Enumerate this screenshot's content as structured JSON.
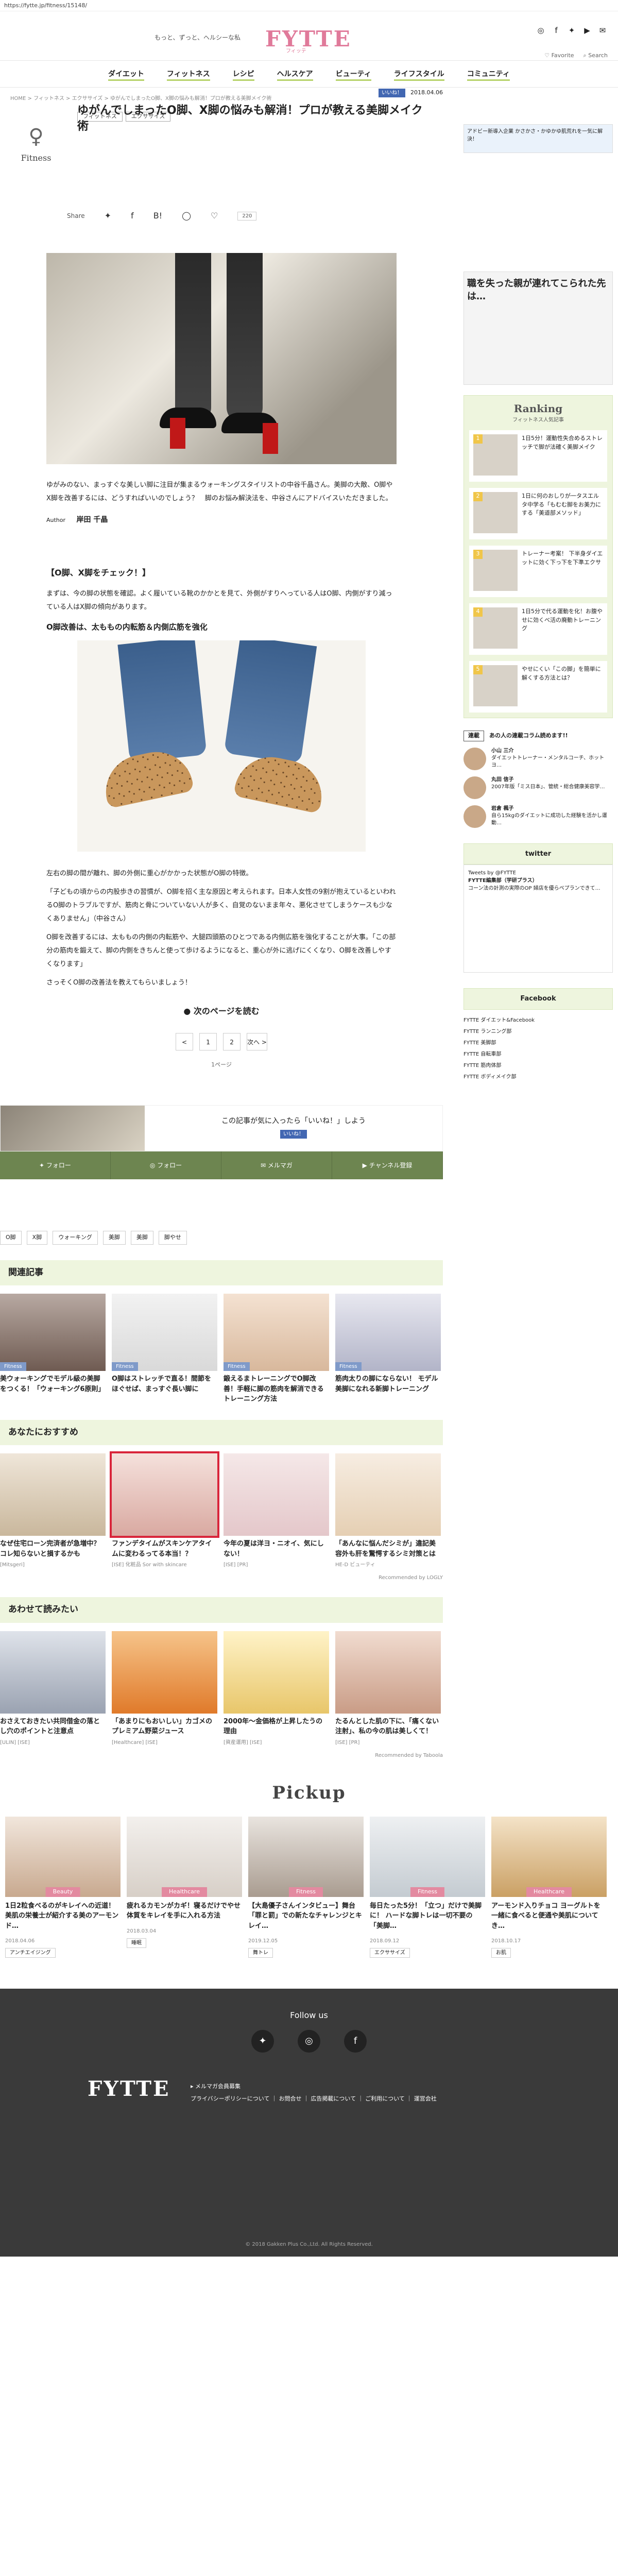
{
  "url": "https://fytte.jp/fitness/15148/",
  "header": {
    "tagline": "もっと、ずっと、ヘルシーな私",
    "logo": "FYTTE",
    "logo_sub": "フィッテ",
    "favorite": "Favorite",
    "search": "Search"
  },
  "nav": [
    "ダイエット",
    "フィットネス",
    "レシピ",
    "ヘルスケア",
    "ビューティ",
    "ライフスタイル",
    "コミュニティ"
  ],
  "breadcrumb": "HOME > フィットネス > エクササイズ > ゆがんでしまったO脚、X脚の悩みも解消！プロが教える美脚メイク術",
  "article": {
    "category": "Fitness",
    "tags": [
      "フィットネス",
      "エクササイズ"
    ],
    "title": "ゆがんでしまったO脚、X脚の悩みも解消！プロが教える美脚メイク術",
    "date": "2018.04.06",
    "like_label": "いいね！",
    "share_label": "Share",
    "share_count": "220",
    "bookmark_label": "B!",
    "lede": "ゆがみのない、まっすぐな美しい脚に注目が集まるウォーキングスタイリストの中谷千晶さん。美脚の大敵、O脚やX脚を改善するには、どうすればいいのでしょう？　脚のお悩み解決法を、中谷さんにアドバイスいただきました。",
    "author_label": "Author",
    "author": "岸田 千晶",
    "sec1_title": "【O脚、X脚をチェック！】",
    "sec1_p": "まずは、今の脚の状態を確認。よく履いている靴のかかとを見て、外側がすりへっている人はO脚、内側がすり減っている人はX脚の傾向があります。",
    "sec1_h3": "O脚改善は、太ももの内転筋＆内側広筋を強化",
    "p2": "左右の脚の間が離れ、脚の外側に重心がかかった状態がO脚の特徴。",
    "p3": "「子どもの頃からの内股歩きの習慣が、O脚を招く主な原因と考えられます。日本人女性の9割が抱えているといわれるO脚のトラブルですが、筋肉と骨についていない人が多く、自覚のないまま年々、悪化させてしまうケースも少なくありません」（中谷さん）",
    "p4": "O脚を改善するには、太ももの内側の内転筋や、大腿四頭筋のひとつである内側広筋を強化することが大事。「この部分の筋肉を鍛えて、脚の内側をきちんと使って歩けるようになると、重心が外に逃げにくくなり、O脚を改善しやすくなります」",
    "p5": "さっそくO脚の改善法を教えてもらいましょう！",
    "next_page": "次のページを読む",
    "pager": [
      "<",
      "1",
      "2",
      "次へ >"
    ],
    "one_page": "1ページ",
    "like_box_text": "この記事が気に入ったら「いいね！」しよう",
    "follow": [
      "フォロー",
      "フォロー",
      "メルマガ",
      "チャンネル登録"
    ],
    "keywords": [
      "O脚",
      "X脚",
      "ウォーキング",
      "美脚",
      "美脚",
      "脚やせ"
    ]
  },
  "related": {
    "title": "関連記事",
    "items": [
      {
        "label": "Fitness",
        "text": "美ウォーキングでモデル級の美脚をつくる！「ウォーキング6原則」"
      },
      {
        "label": "Fitness",
        "text": "O脚はストレッチで直る！間節をほぐせば、まっすぐ長い脚に"
      },
      {
        "label": "Fitness",
        "text": "鍛えるまトレーニングでO脚改善！手軽に脚の筋肉を解消できるトレーニング方法"
      },
      {
        "label": "Fitness",
        "text": "筋肉太りの脚にならない！ モデル美脚になれる新脚トレーニング"
      }
    ]
  },
  "recommend": {
    "title": "あなたにおすすめ",
    "items": [
      {
        "text": "なぜ住宅ローン完済者が急増中？ コレ知らないと損するかも",
        "src": "[Mitsgeri]"
      },
      {
        "text": "ファンデタイムがスキンケアタイムに変わるってる本当！？",
        "src": "[ISE] 化粧品 Sor with skincare"
      },
      {
        "text": "今年の夏は洋ヨ・ニオイ、気にしない！",
        "src": "[ISE] [PR]"
      },
      {
        "text": "「あんなに悩んだシミが」違記美容外も肝を驚愕するシミ対策とは",
        "src": "HE-D ビューティ"
      }
    ],
    "credit": "Recommended by LOGLY"
  },
  "readalso": {
    "title": "あわせて読みたい",
    "items": [
      {
        "text": "おさえておきたい共同借金の落とし穴のポイントと注意点",
        "src": "[ULIN] [ISE]"
      },
      {
        "text": "「あまりにもおいしい」カゴメのプレミアム野菜ジュース",
        "src": "[Healthcare] [ISE]"
      },
      {
        "text": "2000年〜金価格が上昇したうの理由",
        "src": "[資産運用] [ISE]"
      },
      {
        "text": "たるんとした肌の下に、「痛くない注射」、私の今の肌は美しくて！",
        "src": "[ISE] [PR]"
      }
    ],
    "credit": "Recommended by Taboola"
  },
  "pickup": {
    "title": "Pickup",
    "items": [
      {
        "label": "Beauty",
        "text": "1日2粒食べるのがキレイへの近道！美肌の栄養士が紹介する美のアーモンド…",
        "date": "2018.04.06",
        "tag": "アンチエイジング"
      },
      {
        "label": "Healthcare",
        "text": "疲れるカモンがカギ！寝るだけでやせ体質をキレイを手に入れる方法",
        "date": "2018.03.04",
        "tag": "睡眠"
      },
      {
        "label": "Fitness",
        "text": "【大島優子さんインタビュー】舞台「罪と罰」での新たなチャレンジとキレイ…",
        "date": "2019.12.05",
        "tag": "舞トレ"
      },
      {
        "label": "Fitness",
        "text": "毎日たった5分！「立つ」だけで美脚に！ ハードな脚トレは一切不要の「美脚…",
        "date": "2018.09.12",
        "tag": "エクササイズ"
      },
      {
        "label": "Healthcare",
        "text": "アーモンド入りチョコ ヨーグルトを一緒に食べると便通や美肌についてき…",
        "date": "2018.10.17",
        "tag": "お肌"
      }
    ]
  },
  "sidebar": {
    "ad_text": "アドビー新導入企業 かさかさ・かゆかゆ肌荒れを一気に解決！",
    "ad2_text": "職を失った親が連れてこられた先は…",
    "ranking_title": "Ranking",
    "ranking_sub": "フィットネス人気記事",
    "ranking": [
      {
        "n": "1",
        "text": "1日5分！運動性失合めるストレッチで脚が法確く美脚メイク"
      },
      {
        "n": "2",
        "text": "1日に何のおしりが一タスエルタ中学る「もむむ脚をお美力にする「美道部メソッド」"
      },
      {
        "n": "3",
        "text": "トレーナー考案！ 下半身ダイエットに効く下っ下を下準エクサ"
      },
      {
        "n": "4",
        "text": "1日5分で代る運動を化！お腹やせに効くべ活の廃動トレーニング"
      },
      {
        "n": "5",
        "text": "やせにくい「この脚」を簡単に解くする方法とは？"
      }
    ],
    "serial_badge": "連載",
    "serial_title": "あの人の連載コラム読めます!!",
    "people": [
      {
        "name": "小山 三介",
        "desc": "ダイエットトレーナー・メンタルコーチ、ホットヨ…"
      },
      {
        "name": "丸田 信子",
        "desc": "2007年版「ミス日本」、管統・総合健康美容学…"
      },
      {
        "name": "岩倉 楓子",
        "desc": "自ら15kgのダイエットに成功した経験を活かし運動…"
      }
    ],
    "twitter": "twitter",
    "tw_head": "Tweets by @FYTTE",
    "tw_name": "FYTTE編集部（学研プラス）",
    "tw_body": "コーン法の計測の実際のOP 婦店を優らペプランできて…",
    "facebook": "Facebook",
    "fb_links": [
      "FYTTE ダイエット&Facebook",
      "FYTTE ランニング部",
      "FYTTE 美脚部",
      "FYTTE 自転車部",
      "FYTTE 筋肉体部",
      "FYTTE ボディメイク部"
    ]
  },
  "footer": {
    "follow": "Follow us",
    "logo": "FYTTE",
    "mag": "メルマガ会員募集",
    "links": "プライバシーポリシーについて ｜ お問合せ ｜ 広告掲載について ｜ ご利用について ｜ 運営会社",
    "copy": "© 2018 Gakken Plus Co.,Ltd. All Rights Reserved."
  }
}
